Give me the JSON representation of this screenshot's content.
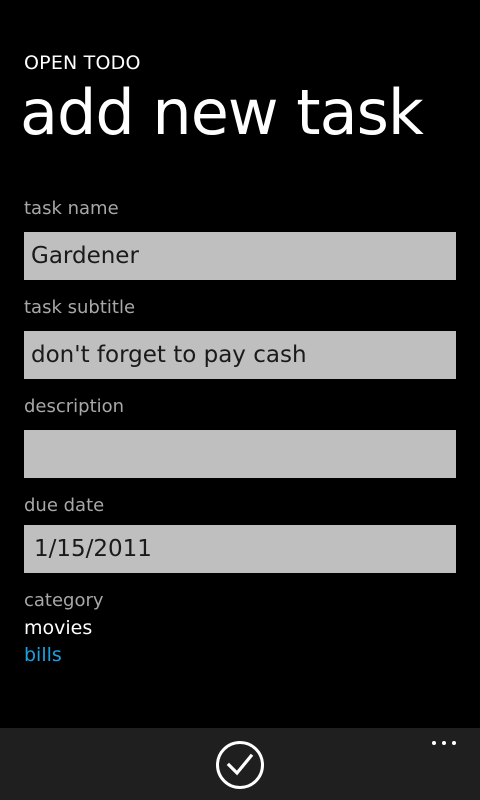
{
  "app": {
    "title": "OPEN TODO",
    "page_title": "add new task"
  },
  "form": {
    "task_name": {
      "label": "task name",
      "value": "Gardener"
    },
    "task_subtitle": {
      "label": "task subtitle",
      "value": "don't forget to pay cash"
    },
    "description": {
      "label": "description",
      "value": ""
    },
    "due_date": {
      "label": "due date",
      "value": "1/15/2011"
    },
    "category": {
      "label": "category",
      "options": [
        "movies",
        "bills"
      ],
      "accent_color": "#1ba1e2"
    }
  },
  "app_bar": {
    "buttons": [
      {
        "icon": "check-icon"
      }
    ],
    "more_icon": "more-ellipsis-icon"
  },
  "colors": {
    "background": "#000000",
    "field_background": "#bfbfbf",
    "label": "#a8a8a8",
    "accent": "#1ba1e2",
    "app_bar": "#1f1f1f"
  }
}
